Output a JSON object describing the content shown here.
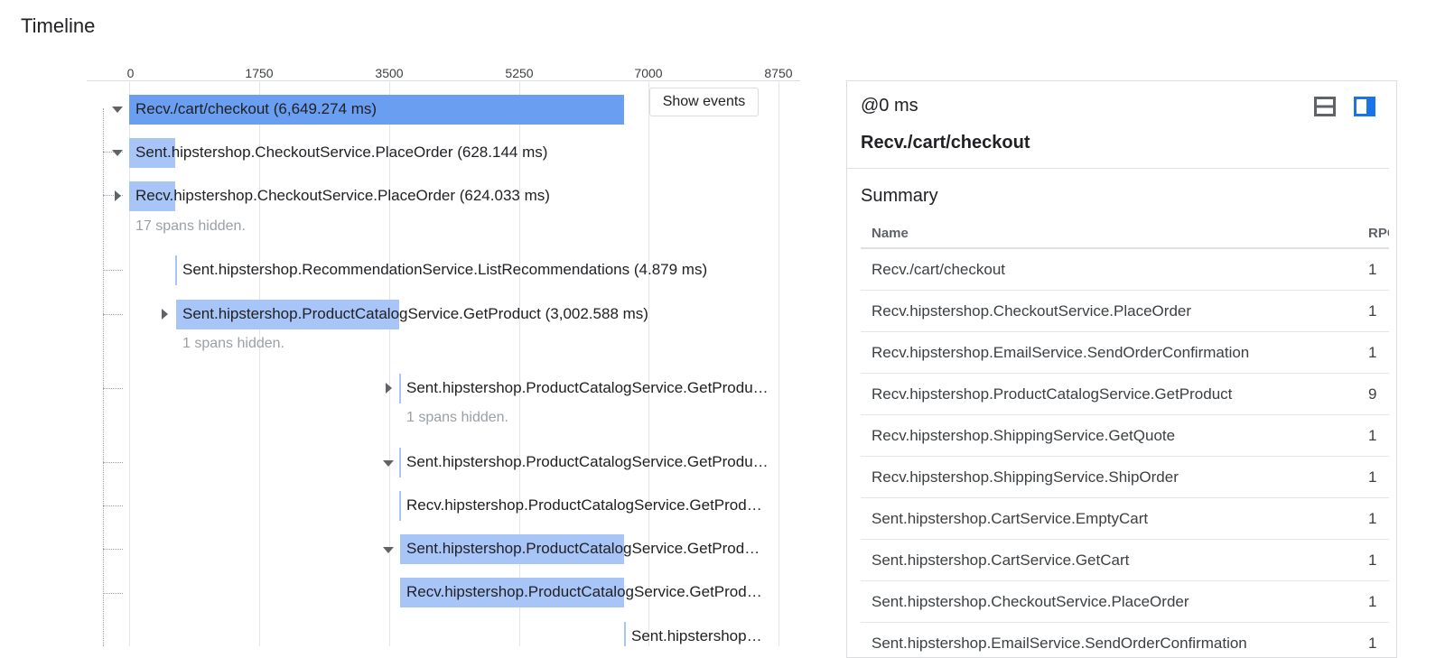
{
  "page": {
    "title": "Timeline"
  },
  "timeline": {
    "axis_ticks": [
      "0",
      "1750",
      "3500",
      "5250",
      "7000",
      "8750"
    ],
    "show_events_label": "Show events",
    "spans": [
      {
        "label": "Recv./cart/checkout (6,649.274 ms)",
        "toggle": "expanded"
      },
      {
        "label": "Sent.hipstershop.CheckoutService.PlaceOrder (628.144 ms)",
        "toggle": "expanded"
      },
      {
        "label": "Recv.hipstershop.CheckoutService.PlaceOrder (624.033 ms)",
        "toggle": "collapsed",
        "hidden_note": "17 spans hidden."
      },
      {
        "label": "Sent.hipstershop.RecommendationService.ListRecommendations (4.879 ms)"
      },
      {
        "label": "Sent.hipstershop.ProductCatalogService.GetProduct (3,002.588 ms)",
        "toggle": "collapsed",
        "hidden_note": "1 spans hidden."
      },
      {
        "label": "Sent.hipstershop.ProductCatalogService.GetProdu…",
        "toggle": "collapsed",
        "hidden_note": "1 spans hidden."
      },
      {
        "label": "Sent.hipstershop.ProductCatalogService.GetProdu…",
        "toggle": "expanded"
      },
      {
        "label": "Recv.hipstershop.ProductCatalogService.GetProd…"
      },
      {
        "label": "Sent.hipstershop.ProductCatalogService.GetProd…",
        "toggle": "expanded"
      },
      {
        "label": "Recv.hipstershop.ProductCatalogService.GetProd…"
      },
      {
        "label": "Sent.hipstershop…"
      }
    ]
  },
  "details": {
    "offset": "@0 ms",
    "span_name": "Recv./cart/checkout",
    "summary_title": "Summary",
    "columns": [
      "Name",
      "RPC"
    ],
    "rows": [
      {
        "name": "Recv./cart/checkout",
        "rpcs": "1"
      },
      {
        "name": "Recv.hipstershop.CheckoutService.PlaceOrder",
        "rpcs": "1"
      },
      {
        "name": "Recv.hipstershop.EmailService.SendOrderConfirmation",
        "rpcs": "1"
      },
      {
        "name": "Recv.hipstershop.ProductCatalogService.GetProduct",
        "rpcs": "9"
      },
      {
        "name": "Recv.hipstershop.ShippingService.GetQuote",
        "rpcs": "1"
      },
      {
        "name": "Recv.hipstershop.ShippingService.ShipOrder",
        "rpcs": "1"
      },
      {
        "name": "Sent.hipstershop.CartService.EmptyCart",
        "rpcs": "1"
      },
      {
        "name": "Sent.hipstershop.CartService.GetCart",
        "rpcs": "1"
      },
      {
        "name": "Sent.hipstershop.CheckoutService.PlaceOrder",
        "rpcs": "1"
      },
      {
        "name": "Sent.hipstershop.EmailService.SendOrderConfirmation",
        "rpcs": "1"
      }
    ]
  },
  "icons": {
    "stacked_layout": "stacked-layout-icon",
    "side_layout": "side-panel-layout-icon"
  },
  "colors": {
    "root_bar": "#6a9ef0",
    "span_bar": "#a8c5f7",
    "active_icon": "#1a73e8",
    "inactive_icon": "#5f6368"
  }
}
